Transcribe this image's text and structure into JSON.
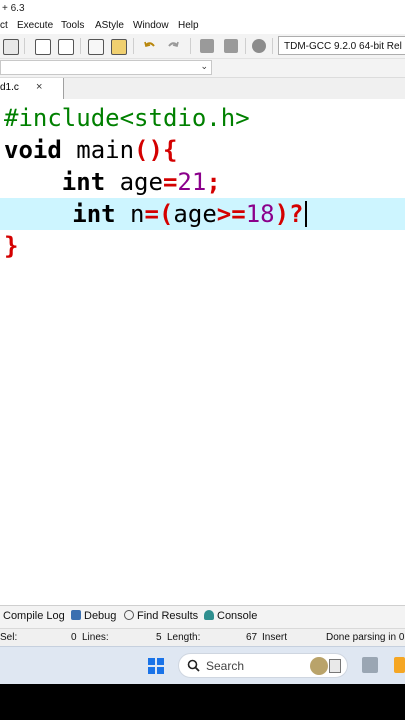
{
  "window": {
    "title_fragment": "+ 6.3"
  },
  "menu": [
    "ct",
    "Execute",
    "Tools",
    "AStyle",
    "Window",
    "Help"
  ],
  "toolbar": {
    "compiler": "TDM-GCC 9.2.0 64-bit Rel"
  },
  "tab": {
    "filename": "d1.c",
    "close": "×"
  },
  "code": {
    "l1": "#include<stdio.h>",
    "l2_kw": "void",
    "l2_name": " main",
    "l2_sym": "(){",
    "l3_kw": "int",
    "l3_var": " age",
    "l3_eq": "=",
    "l3_num": "21",
    "l3_semi": ";",
    "l4_kw": "int",
    "l4_var": " n",
    "l4_eq": "=(",
    "l4_var2": "age",
    "l4_op": ">=",
    "l4_num": "18",
    "l4_end": ")?",
    "l5": "}"
  },
  "bottom_tabs": [
    "Compile Log",
    "Debug",
    "Find Results",
    "Console"
  ],
  "status": {
    "sel_label": "Sel:",
    "sel_value": "0",
    "lines_label": "Lines:",
    "lines_value": "5",
    "length_label": "Length:",
    "length_value": "67",
    "mode": "Insert",
    "message": "Done parsing in 0"
  },
  "taskbar": {
    "search_label": "Search"
  },
  "colors": {
    "active_line": "#cdf5ff",
    "preprocessor": "#008000",
    "number": "#8b008b",
    "symbol": "#d40000"
  }
}
